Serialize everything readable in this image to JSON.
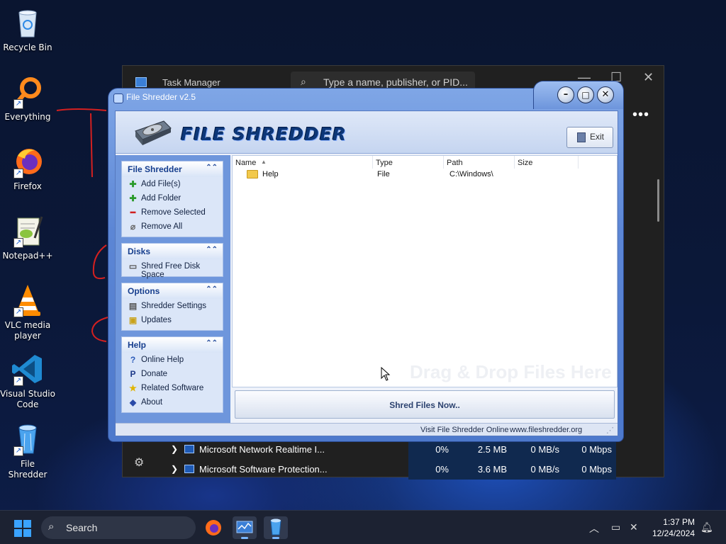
{
  "desktop": {
    "icons": [
      {
        "label": "Recycle Bin",
        "icon": "recycle-bin-icon"
      },
      {
        "label": "Everything",
        "icon": "everything-search-icon"
      },
      {
        "label": "Firefox",
        "icon": "firefox-icon"
      },
      {
        "label": "Notepad++",
        "icon": "notepadpp-icon"
      },
      {
        "label": "VLC media player",
        "icon": "vlc-icon"
      },
      {
        "label": "Visual Studio Code",
        "icon": "vscode-icon"
      },
      {
        "label": "File Shredder",
        "icon": "file-shredder-icon"
      }
    ]
  },
  "task_manager": {
    "title": "Task Manager",
    "search_placeholder": "Type a name, publisher, or PID...",
    "more": "•••",
    "rows": [
      {
        "name": "Microsoft Network Realtime I...",
        "cpu": "0%",
        "memory": "2.5 MB",
        "disk": "0 MB/s",
        "network": "0 Mbps"
      },
      {
        "name": "Microsoft Software Protection...",
        "cpu": "0%",
        "memory": "3.6 MB",
        "disk": "0 MB/s",
        "network": "0 Mbps"
      }
    ]
  },
  "shredder": {
    "window_title": "File Shredder v2.5",
    "logo_text": "FILE SHREDDER",
    "exit_label": "Exit",
    "panels": {
      "file_shredder": {
        "title": "File Shredder",
        "items": [
          "Add File(s)",
          "Add Folder",
          "Remove Selected",
          "Remove All"
        ]
      },
      "disks": {
        "title": "Disks",
        "items": [
          "Shred Free Disk Space"
        ]
      },
      "options": {
        "title": "Options",
        "items": [
          "Shredder Settings",
          "Updates"
        ]
      },
      "help": {
        "title": "Help",
        "items": [
          "Online Help",
          "Donate",
          "Related Software",
          "About"
        ]
      }
    },
    "columns": {
      "name": "Name",
      "type": "Type",
      "path": "Path",
      "size": "Size"
    },
    "files": [
      {
        "name": "Help",
        "type": "File",
        "path": "C:\\Windows\\",
        "size": ""
      }
    ],
    "drop_hint": "Drag & Drop Files Here",
    "shred_button": "Shred Files Now..",
    "status": {
      "visit": "Visit File Shredder Online",
      "url": "www.fileshredder.org"
    }
  },
  "taskbar": {
    "search_placeholder": "Search",
    "time": "1:37 PM",
    "date": "12/24/2024"
  }
}
